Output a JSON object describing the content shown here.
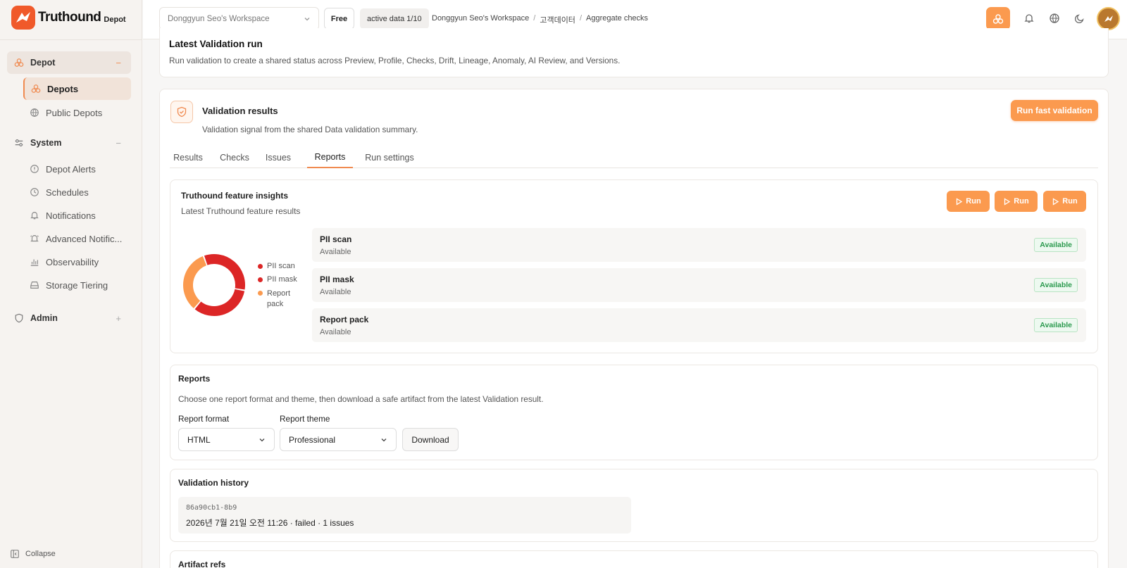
{
  "brand": {
    "name": "Truthound",
    "sub": "Depot"
  },
  "sidebar": {
    "groups": [
      {
        "label": "Depot",
        "toggle": "−"
      },
      {
        "label": "System",
        "toggle": "−"
      },
      {
        "label": "Admin",
        "toggle": "+"
      }
    ],
    "depot_items": [
      {
        "label": "Depots"
      },
      {
        "label": "Public Depots"
      }
    ],
    "system_items": [
      {
        "label": "Depot Alerts"
      },
      {
        "label": "Schedules"
      },
      {
        "label": "Notifications"
      },
      {
        "label": "Advanced Notific..."
      },
      {
        "label": "Observability"
      },
      {
        "label": "Storage Tiering"
      }
    ],
    "collapse_label": "Collapse"
  },
  "topbar": {
    "workspace": "Donggyun Seo's Workspace",
    "plan": "Free",
    "active_data": "active data 1/10",
    "breadcrumb": [
      "Donggyun Seo's Workspace",
      "고객데이터",
      "Aggregate checks"
    ],
    "breadcrumb_sep": "/"
  },
  "latest": {
    "title": "Latest Validation run",
    "subtitle": "Run validation to create a shared status across Preview, Profile, Checks, Drift, Lineage, Anomaly, AI Review, and Versions."
  },
  "validation": {
    "title": "Validation results",
    "subtitle": "Validation signal from the shared Data validation summary.",
    "run_fast": "Run fast validation",
    "tabs": [
      "Results",
      "Checks",
      "Issues",
      "Reports",
      "Run settings"
    ],
    "active_tab": "Reports"
  },
  "insights": {
    "title": "Truthound feature insights",
    "subtitle": "Latest Truthound feature results",
    "run_label": "Run",
    "features": [
      {
        "name": "PII scan",
        "status": "Available",
        "badge": "Available"
      },
      {
        "name": "PII mask",
        "status": "Available",
        "badge": "Available"
      },
      {
        "name": "Report pack",
        "status": "Available",
        "badge": "Available"
      }
    ]
  },
  "chart_data": {
    "type": "pie",
    "donut": true,
    "categories": [
      "PII scan",
      "PII mask",
      "Report pack"
    ],
    "values": [
      1,
      1,
      1
    ],
    "colors": [
      "#dc2626",
      "#dc2626",
      "#fb9a4f"
    ],
    "legend": [
      "PII scan",
      "PII mask",
      "Report pack"
    ],
    "legend_placement": "right"
  },
  "reports": {
    "title": "Reports",
    "subtitle": "Choose one report format and theme, then download a safe artifact from the latest Validation result.",
    "format_label": "Report format",
    "format_value": "HTML",
    "theme_label": "Report theme",
    "theme_value": "Professional",
    "download_label": "Download"
  },
  "history": {
    "title": "Validation history",
    "items": [
      {
        "id": "86a90cb1-8b9",
        "desc": "2026년 7월 21일 오전 11:26 · failed · 1 issues"
      }
    ]
  },
  "artifacts": {
    "title": "Artifact refs"
  },
  "colors": {
    "accent": "#fb9a4f",
    "brand": "#f0592a",
    "success": "#2b9a4e",
    "danger": "#dc2626"
  }
}
